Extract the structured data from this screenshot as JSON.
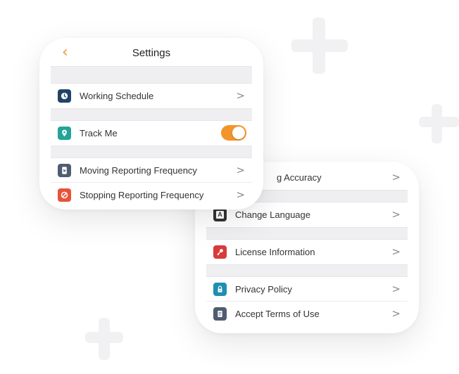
{
  "colors": {
    "accent": "#f2952c",
    "schedule_icon_bg": "#1f4466",
    "track_icon_bg": "#22a596",
    "moving_icon_bg": "#4f5d70",
    "stopping_icon_bg": "#e8523a",
    "language_icon_bg": "#333333",
    "license_icon_bg": "#d93a3a",
    "privacy_icon_bg": "#1f8fb0",
    "terms_icon_bg": "#4f5d70"
  },
  "header": {
    "back_icon": "chevron-left-icon",
    "title": "Settings"
  },
  "settings_card": {
    "rows": [
      {
        "label": "Working Schedule",
        "icon": "clock-icon",
        "control": "chevron"
      },
      {
        "label": "Track Me",
        "icon": "location-pin-icon",
        "control": "toggle",
        "toggle_on": true
      },
      {
        "label": "Moving Reporting Frequency",
        "icon": "moving-phone-icon",
        "control": "chevron"
      },
      {
        "label": "Stopping Reporting Frequency",
        "icon": "stop-icon",
        "control": "chevron"
      }
    ]
  },
  "second_card": {
    "rows": [
      {
        "label": "g Accuracy",
        "control": "chevron"
      },
      {
        "label": "Change Language",
        "icon": "language-icon",
        "icon_glyph": "A",
        "control": "chevron"
      },
      {
        "label": "License Information",
        "icon": "key-icon",
        "control": "chevron"
      },
      {
        "label": "Privacy Policy",
        "icon": "lock-icon",
        "control": "chevron"
      },
      {
        "label": "Accept Terms of Use",
        "icon": "document-icon",
        "control": "chevron"
      }
    ]
  },
  "chevron_glyph": ">"
}
